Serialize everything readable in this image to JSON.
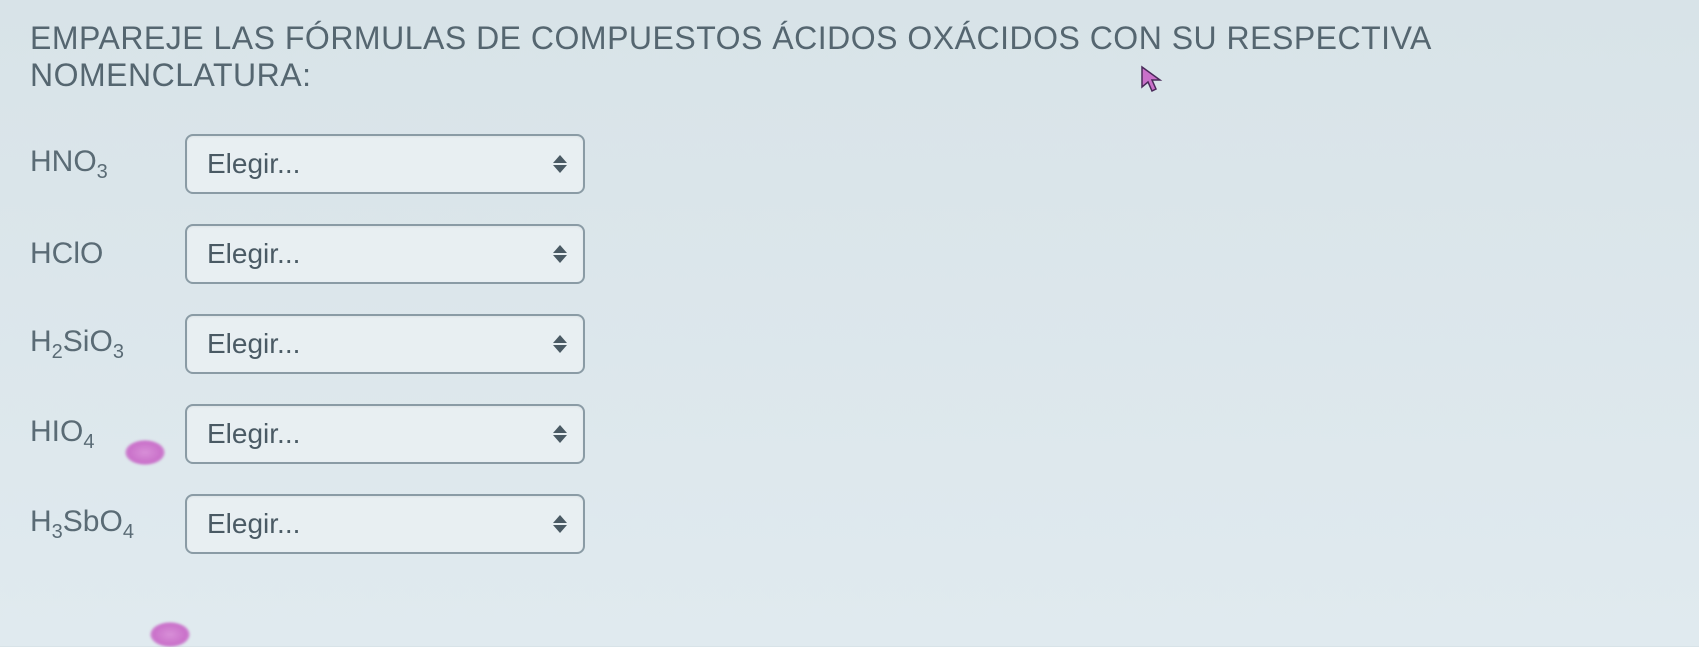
{
  "question": {
    "title": "EMPAREJE LAS FÓRMULAS DE COMPUESTOS ÁCIDOS OXÁCIDOS CON SU RESPECTIVA NOMENCLATURA:"
  },
  "rows": [
    {
      "formula_html": "HNO<sub>3</sub>",
      "formula_plain": "HNO3",
      "select_placeholder": "Elegir..."
    },
    {
      "formula_html": "HClO",
      "formula_plain": "HClO",
      "select_placeholder": "Elegir..."
    },
    {
      "formula_html": "H<sub>2</sub>SiO<sub>3</sub>",
      "formula_plain": "H2SiO3",
      "select_placeholder": "Elegir..."
    },
    {
      "formula_html": "HIO<sub>4</sub>",
      "formula_plain": "HIO4",
      "select_placeholder": "Elegir..."
    },
    {
      "formula_html": "H<sub>3</sub>SbO<sub>4</sub>",
      "formula_plain": "H3SbO4",
      "select_placeholder": "Elegir..."
    }
  ]
}
